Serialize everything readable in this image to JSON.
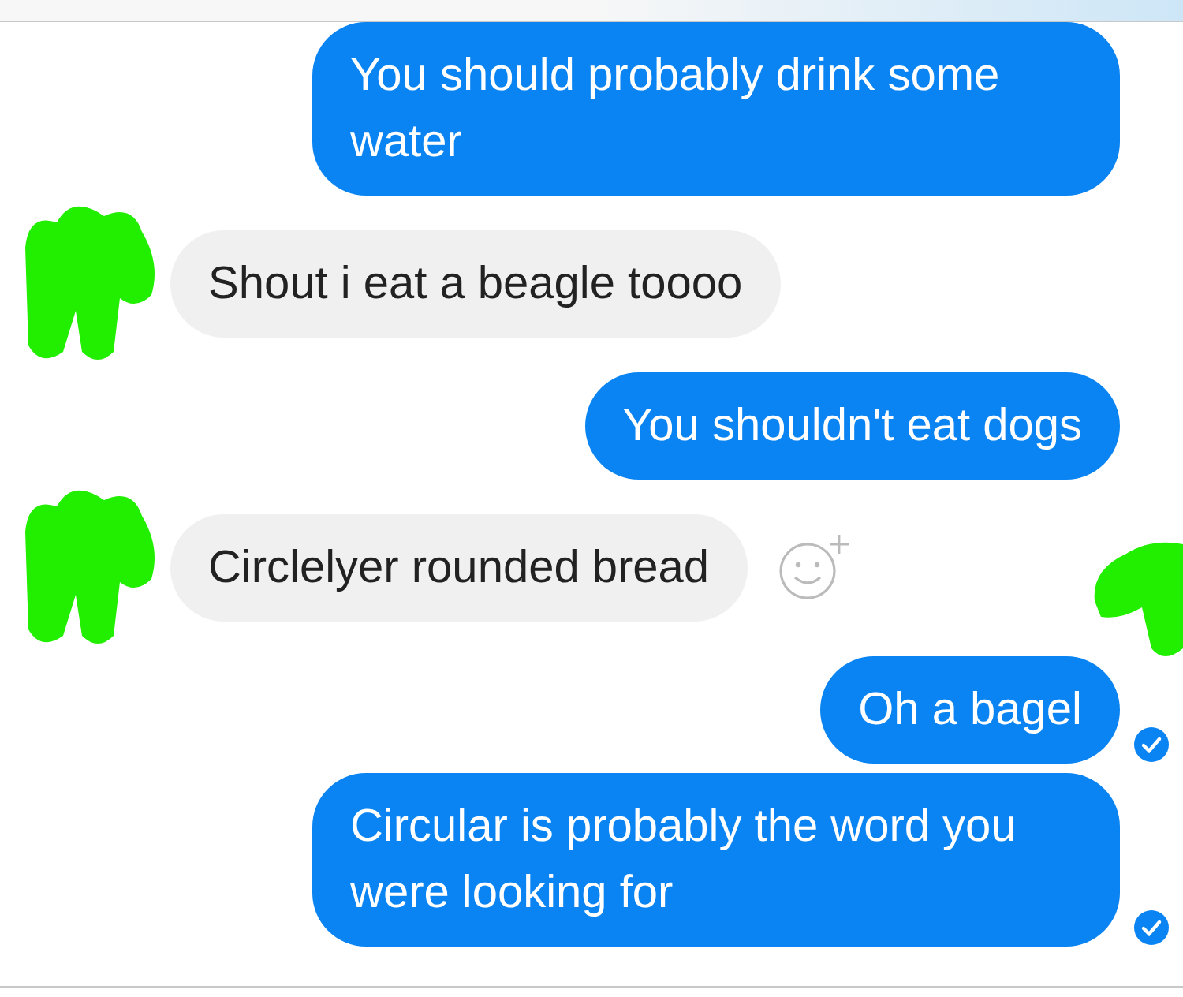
{
  "messages": [
    {
      "kind": "sent",
      "text": "You should probably drink some water",
      "delivered": false,
      "seen": false,
      "reaction_button": false
    },
    {
      "kind": "received",
      "text": "Shout i eat a beagle toooo",
      "delivered": false,
      "seen": false,
      "reaction_button": false
    },
    {
      "kind": "sent",
      "text": "You shouldn't eat dogs",
      "delivered": false,
      "seen": false,
      "reaction_button": false
    },
    {
      "kind": "received",
      "text": "Circlelyer rounded bread",
      "delivered": false,
      "seen": true,
      "reaction_button": true
    },
    {
      "kind": "sent",
      "text": "Oh a bagel",
      "delivered": true,
      "seen": false,
      "reaction_button": false
    },
    {
      "kind": "sent",
      "text": "Circular is probably the word you were looking for",
      "delivered": true,
      "seen": false,
      "reaction_button": false
    }
  ]
}
